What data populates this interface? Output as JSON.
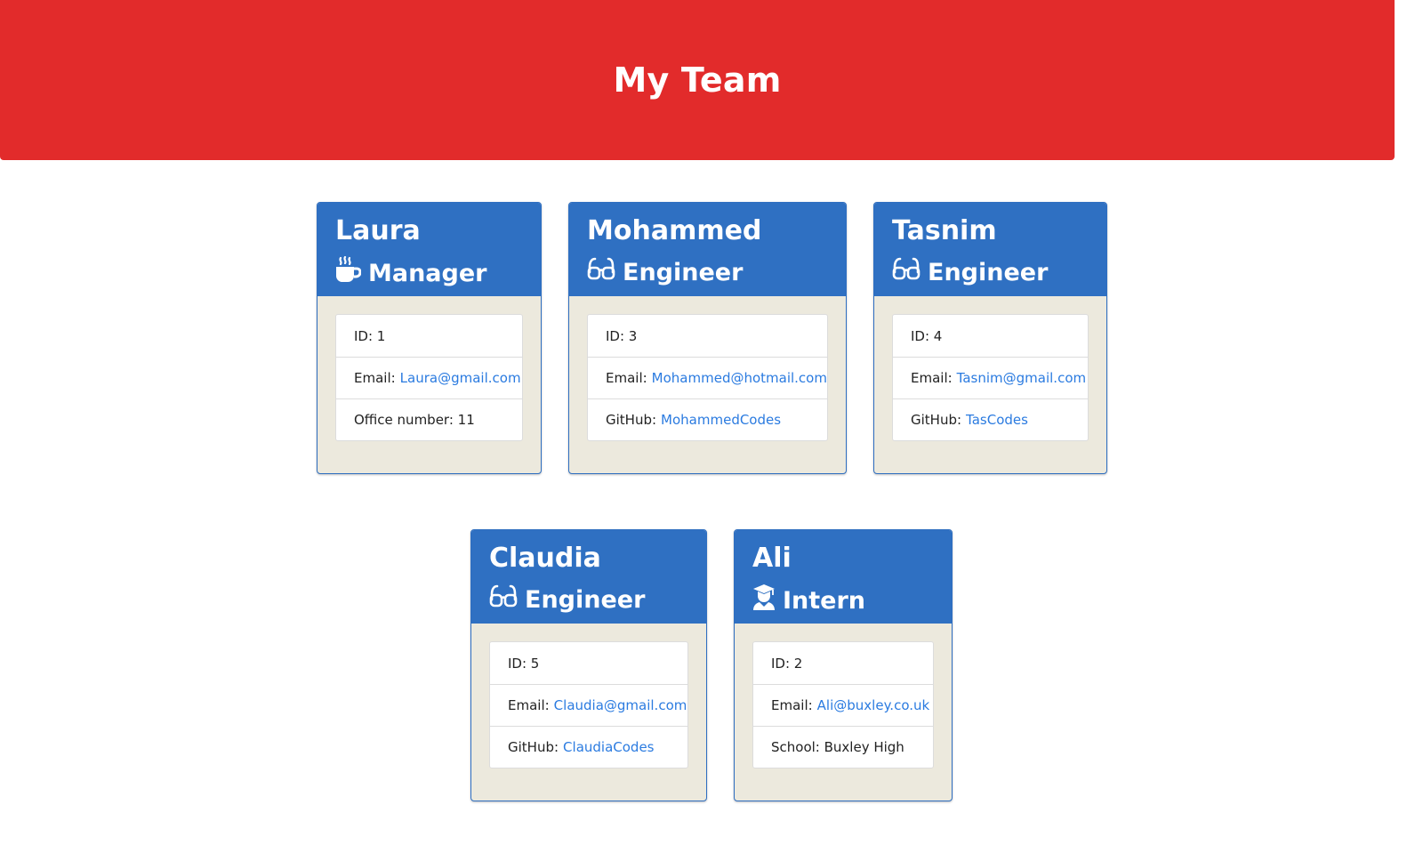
{
  "header": {
    "title": "My Team"
  },
  "colors": {
    "header_bg": "#e22b2b",
    "card_header_bg": "#2f70c2",
    "card_body_bg": "#ece9dd",
    "link": "#2b7be0"
  },
  "cards": [
    {
      "name": "Laura",
      "role": "Manager",
      "role_icon": "coffee-icon",
      "id_text": "ID: 1",
      "email_label": "Email:",
      "email": "Laura@gmail.com",
      "extra_label": "Office number: 11",
      "extra_value": ""
    },
    {
      "name": "Mohammed",
      "role": "Engineer",
      "role_icon": "glasses-icon",
      "id_text": "ID: 3",
      "email_label": "Email:",
      "email": "Mohammed@hotmail.com",
      "extra_label": "GitHub:",
      "extra_value": "MohammedCodes"
    },
    {
      "name": "Tasnim",
      "role": "Engineer",
      "role_icon": "glasses-icon",
      "id_text": "ID: 4",
      "email_label": "Email:",
      "email": "Tasnim@gmail.com",
      "extra_label": "GitHub:",
      "extra_value": "TasCodes"
    },
    {
      "name": "Claudia",
      "role": "Engineer",
      "role_icon": "glasses-icon",
      "id_text": "ID: 5",
      "email_label": "Email:",
      "email": "Claudia@gmail.com",
      "extra_label": "GitHub:",
      "extra_value": "ClaudiaCodes"
    },
    {
      "name": "Ali",
      "role": "Intern",
      "role_icon": "graduate-icon",
      "id_text": "ID: 2",
      "email_label": "Email:",
      "email": "Ali@buxley.co.uk",
      "extra_label": "School: Buxley High",
      "extra_value": ""
    }
  ]
}
